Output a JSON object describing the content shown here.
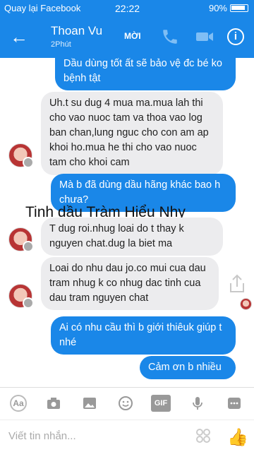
{
  "status": {
    "carrier": "Quay lại Facebook",
    "time": "22:22",
    "battery": "90%"
  },
  "header": {
    "name": "Thoan Vu",
    "sub": "2Phút",
    "invite": "MỜI"
  },
  "messages": [
    {
      "text": "Dầu dùng tốt ất sẽ bảo vệ đc bé ko bệnh tật"
    },
    {
      "text": "Uh.t su dug 4 mua ma.mua lah thi cho vao nuoc tam va thoa vao log ban chan,lung nguc cho con am ap khoi ho.mua he thi cho vao nuoc tam cho khoi cam"
    },
    {
      "text": "Mà b đã dùng dầu hãng khác bao h chưa?"
    },
    {
      "text": "T dug roi.nhug loai do t thay k nguyen chat.dug la biet ma"
    },
    {
      "text": "Loai do nhu dau jo.co mui cua dau tram nhug k co nhug dac tinh cua dau tram nguyen chat"
    },
    {
      "text": "Ai có nhu cầu thì b giới thiêuk giúp t nhé"
    },
    {
      "text": "Cảm ơn b nhiều"
    }
  ],
  "watermark": "Tinh dầu Tràm Hiểu Nhy",
  "composer": {
    "placeholder": "Viết tin nhắn...",
    "aa": "Aa",
    "gif": "GIF"
  }
}
